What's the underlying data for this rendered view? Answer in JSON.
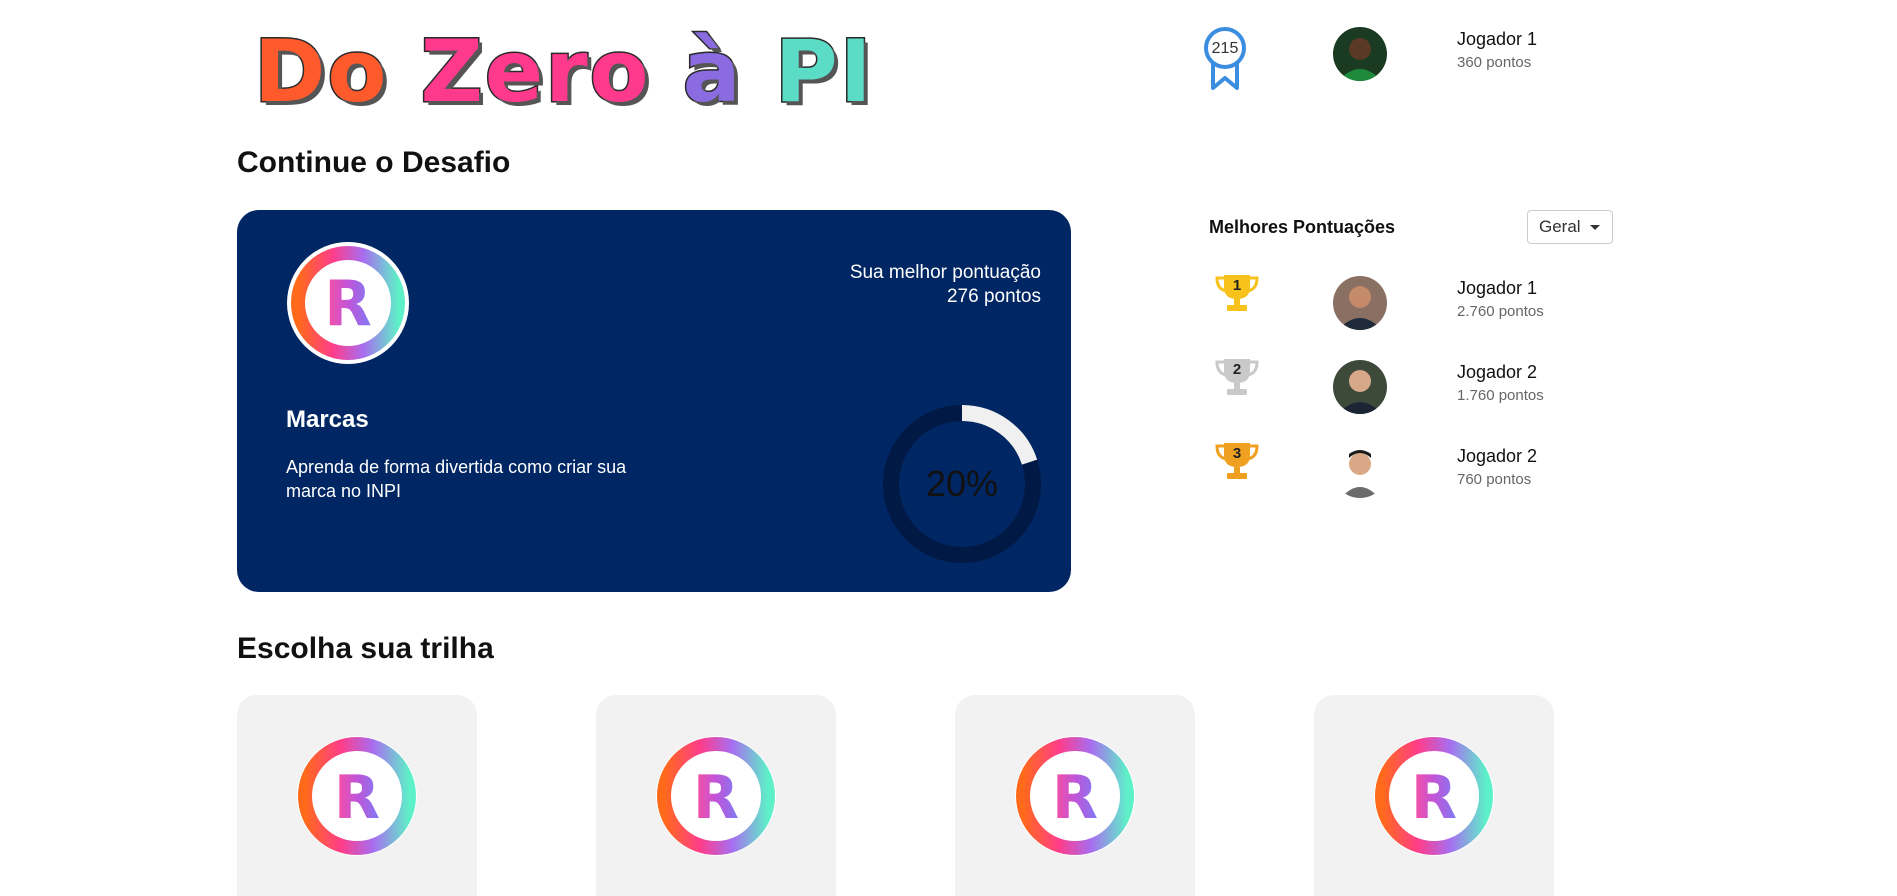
{
  "logo": {
    "parts": [
      "Do",
      "Zero",
      "à",
      "PI"
    ]
  },
  "header": {
    "level": "215",
    "user_name": "Jogador 1",
    "user_points": "360 pontos"
  },
  "continue_section": {
    "title": "Continue o Desafio",
    "card": {
      "best_label": "Sua melhor pontuação",
      "best_value": "276 pontos",
      "title": "Marcas",
      "description": "Aprenda de forma divertida como criar sua marca no INPI",
      "progress_label": "20%",
      "progress": 0.2
    }
  },
  "ranking": {
    "title": "Melhores Pontuações",
    "filter": "Geral",
    "entries": [
      {
        "position": "1",
        "name": "Jogador 1",
        "points": "2.760 pontos"
      },
      {
        "position": "2",
        "name": "Jogador 2",
        "points": "1.760 pontos"
      },
      {
        "position": "3",
        "name": "Jogador 2",
        "points": "760 pontos"
      }
    ]
  },
  "trails_section": {
    "title": "Escolha sua trilha"
  },
  "colors": {
    "card_bg": "#002663",
    "trophy_gold": "#f7c21b",
    "trophy_silver": "#c9c9c9",
    "trophy_bronze": "#f0a020",
    "medal_blue": "#3b8de0"
  },
  "icons": {
    "medal": "ribbon-medal-icon",
    "trophy": "trophy-icon",
    "trail": "registered-trademark-icon"
  }
}
